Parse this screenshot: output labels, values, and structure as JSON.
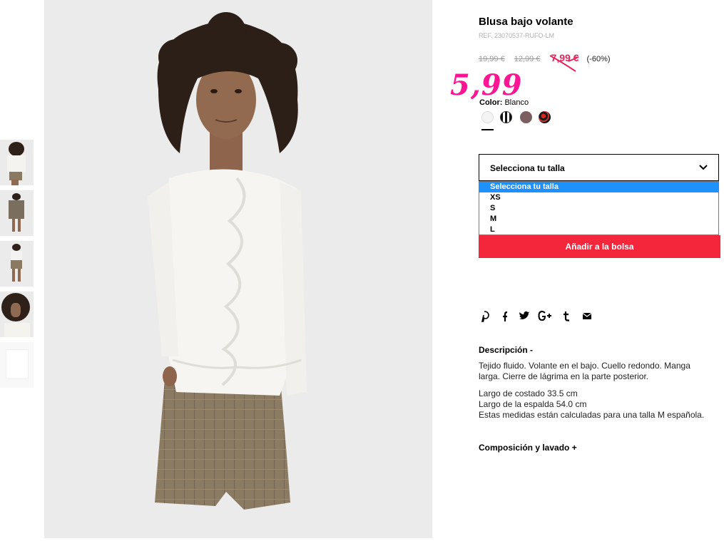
{
  "product": {
    "title": "Blusa bajo volante",
    "ref": "REF. 23070537-RUFO-LM",
    "price_original": "19,99 €",
    "price_previous": "12,99 €",
    "price_sale": "7,99 €",
    "discount": "(-60%)",
    "annotated_price": "5,99"
  },
  "color": {
    "label": "Color:",
    "value": "Blanco",
    "swatches": [
      {
        "name": "blanco",
        "hex": "#f4f4f4",
        "selected": true
      },
      {
        "name": "rayas",
        "hex": "#111111"
      },
      {
        "name": "malva",
        "hex": "#7a5e60"
      },
      {
        "name": "estampado",
        "hex": "#c33333"
      }
    ]
  },
  "size_select": {
    "selected": "Selecciona tu talla",
    "options": [
      "Selecciona tu talla",
      "XS",
      "S",
      "M",
      "L"
    ]
  },
  "add_to_bag": "Añadir a la bolsa",
  "social": {
    "pinterest": "P",
    "facebook": "f",
    "twitter": "t-bird",
    "googleplus": "G+",
    "tumblr": "t",
    "email": "mail"
  },
  "description": {
    "heading": "Descripción  -",
    "paragraph1": "Tejido fluido. Volante en el bajo. Cuello redondo. Manga larga. Cierre de lágrima en la parte posterior.",
    "line1": "Largo de costado 33.5 cm",
    "line2": "Largo de la espalda 54.0 cm",
    "line3": "Estas medidas están calculadas para una talla M española."
  },
  "composition": {
    "heading": "Composición y lavado  +"
  },
  "colors": {
    "sale": "#e8235c",
    "annotation": "#ff1493",
    "button": "#f4263c",
    "option_highlight": "#1e90ff"
  }
}
